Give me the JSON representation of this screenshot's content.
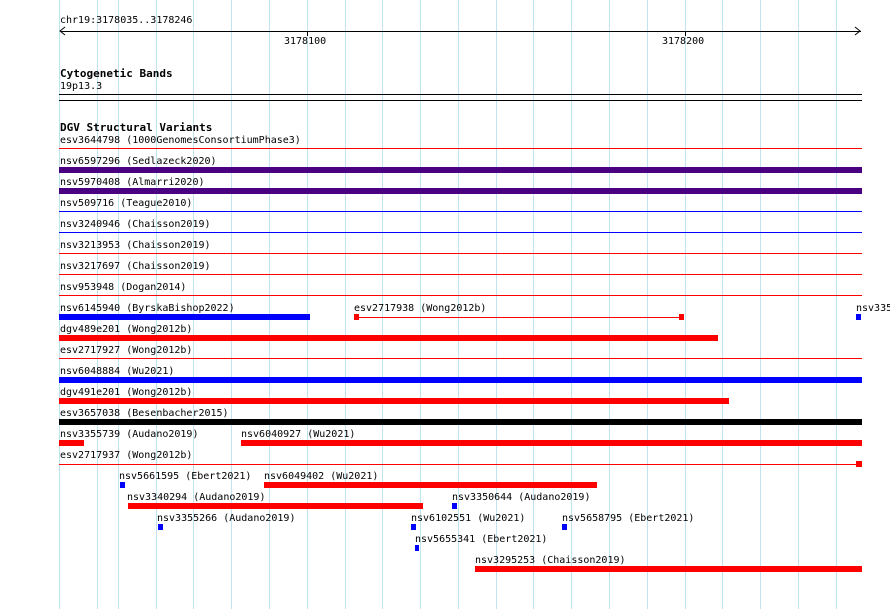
{
  "browser": {
    "ruler": {
      "region_label": "chr19:3178035..3178246",
      "tick_labels": [
        "3178100",
        "3178200"
      ]
    },
    "cyto": {
      "title": "Cytogenetic Bands",
      "band": "19p13.3"
    },
    "dgv": {
      "title": "DGV Structural Variants",
      "labels": {
        "esv3644798": "esv3644798 (1000GenomesConsortiumPhase3)",
        "nsv6597296": "nsv6597296 (Sedlazeck2020)",
        "nsv5970408": "nsv5970408 (Almarri2020)",
        "nsv509716": "nsv509716 (Teague2010)",
        "nsv3240946": "nsv3240946 (Chaisson2019)",
        "nsv3213953": "nsv3213953 (Chaisson2019)",
        "nsv3217697": "nsv3217697 (Chaisson2019)",
        "nsv953948": "nsv953948 (Dogan2014)",
        "nsv6145940": "nsv6145940 (ByrskaBishop2022)",
        "esv2717938": "esv2717938 (Wong2012b)",
        "nsv335_trunc": "nsv335",
        "dgv489e201": "dgv489e201 (Wong2012b)",
        "esv2717927": "esv2717927 (Wong2012b)",
        "nsv6048884": "nsv6048884 (Wu2021)",
        "dgv491e201": "dgv491e201 (Wong2012b)",
        "esv3657038": "esv3657038 (Besenbacher2015)",
        "nsv3355739": "nsv3355739 (Audano2019)",
        "nsv6040927": "nsv6040927 (Wu2021)",
        "esv2717937": "esv2717937 (Wong2012b)",
        "nsv5661595": "nsv5661595 (Ebert2021)",
        "nsv6049402": "nsv6049402 (Wu2021)",
        "nsv3340294": "nsv3340294 (Audano2019)",
        "nsv3350644": "nsv3350644 (Audano2019)",
        "nsv3355266": "nsv3355266 (Audano2019)",
        "nsv6102551": "nsv6102551 (Wu2021)",
        "nsv5658795": "nsv5658795 (Ebert2021)",
        "nsv5655341": "nsv5655341 (Ebert2021)",
        "nsv3295253": "nsv3295253 (Chaisson2019)"
      }
    },
    "colors": {
      "loss": "#ff0000",
      "gain": "#0000ff",
      "gain_loss": "#4b0082",
      "complex": "#000000",
      "grid": "#bfe4f0"
    }
  }
}
